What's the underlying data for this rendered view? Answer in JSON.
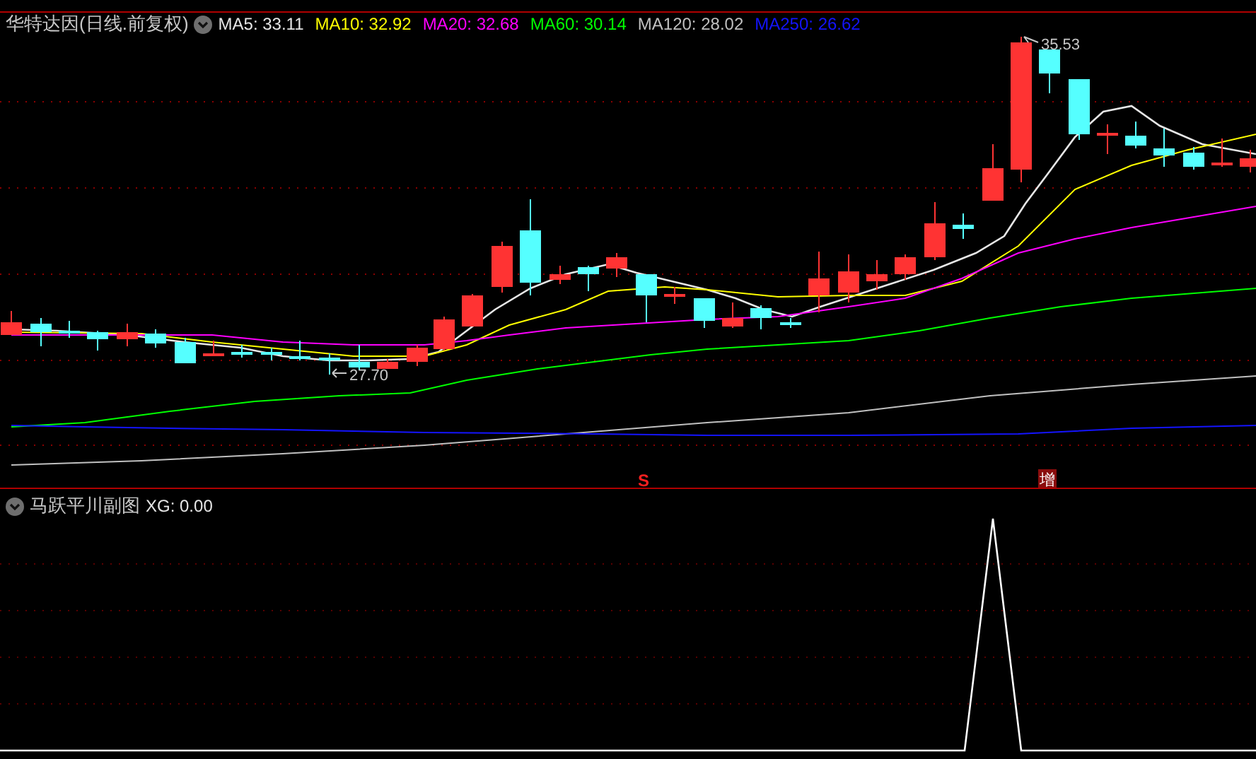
{
  "main_chart": {
    "title": "华特达因(日线.前复权)",
    "indicators": [
      {
        "label": "MA5: 33.11",
        "color": "#e6e6e6"
      },
      {
        "label": "MA10: 32.92",
        "color": "#ffff00"
      },
      {
        "label": "MA20: 32.68",
        "color": "#ff00ff"
      },
      {
        "label": "MA60: 30.14",
        "color": "#00ff00"
      },
      {
        "label": "MA120: 28.02",
        "color": "#c0c0c0"
      },
      {
        "label": "MA250: 26.62",
        "color": "#1414ff"
      }
    ],
    "high_label": "35.53",
    "low_label": "27.70",
    "signals": [
      {
        "kind": "sell",
        "text": "S"
      },
      {
        "kind": "add",
        "text": "增"
      }
    ]
  },
  "sub_chart": {
    "title": "马跃平川副图",
    "value": "XG: 0.00"
  }
}
